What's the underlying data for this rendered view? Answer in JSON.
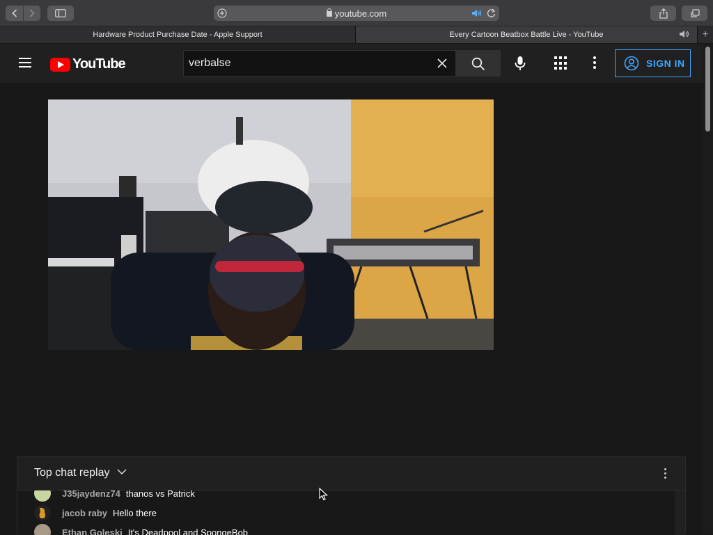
{
  "browser": {
    "url": "youtube.com",
    "tabs": [
      {
        "title": "Hardware Product Purchase Date - Apple Support",
        "active": false
      },
      {
        "title": "Every Cartoon Beatbox Battle Live - YouTube",
        "active": true
      }
    ],
    "new_tab_symbol": "+"
  },
  "youtube": {
    "logo_text": "YouTube",
    "search": {
      "value": "verbalse",
      "placeholder": "Search"
    },
    "sign_in_label": "SIGN IN",
    "icons": [
      "menu-icon",
      "youtube-logo",
      "clear-icon",
      "search-icon",
      "mic-icon",
      "apps-icon",
      "more-icon",
      "account-icon"
    ]
  },
  "chat": {
    "title": "Top chat replay",
    "messages": [
      {
        "author": "J35jaydenz74",
        "text": "thanos vs Patrick"
      },
      {
        "author": "jacob raby",
        "text": "Hello there"
      },
      {
        "author": "Ethan Goleski",
        "text": "It's Deadpool and SpongeBob"
      }
    ]
  },
  "colors": {
    "accent": "#3ea6ff",
    "brand_red": "#ff0000",
    "page_bg": "#181818",
    "header_bg": "#202020"
  }
}
